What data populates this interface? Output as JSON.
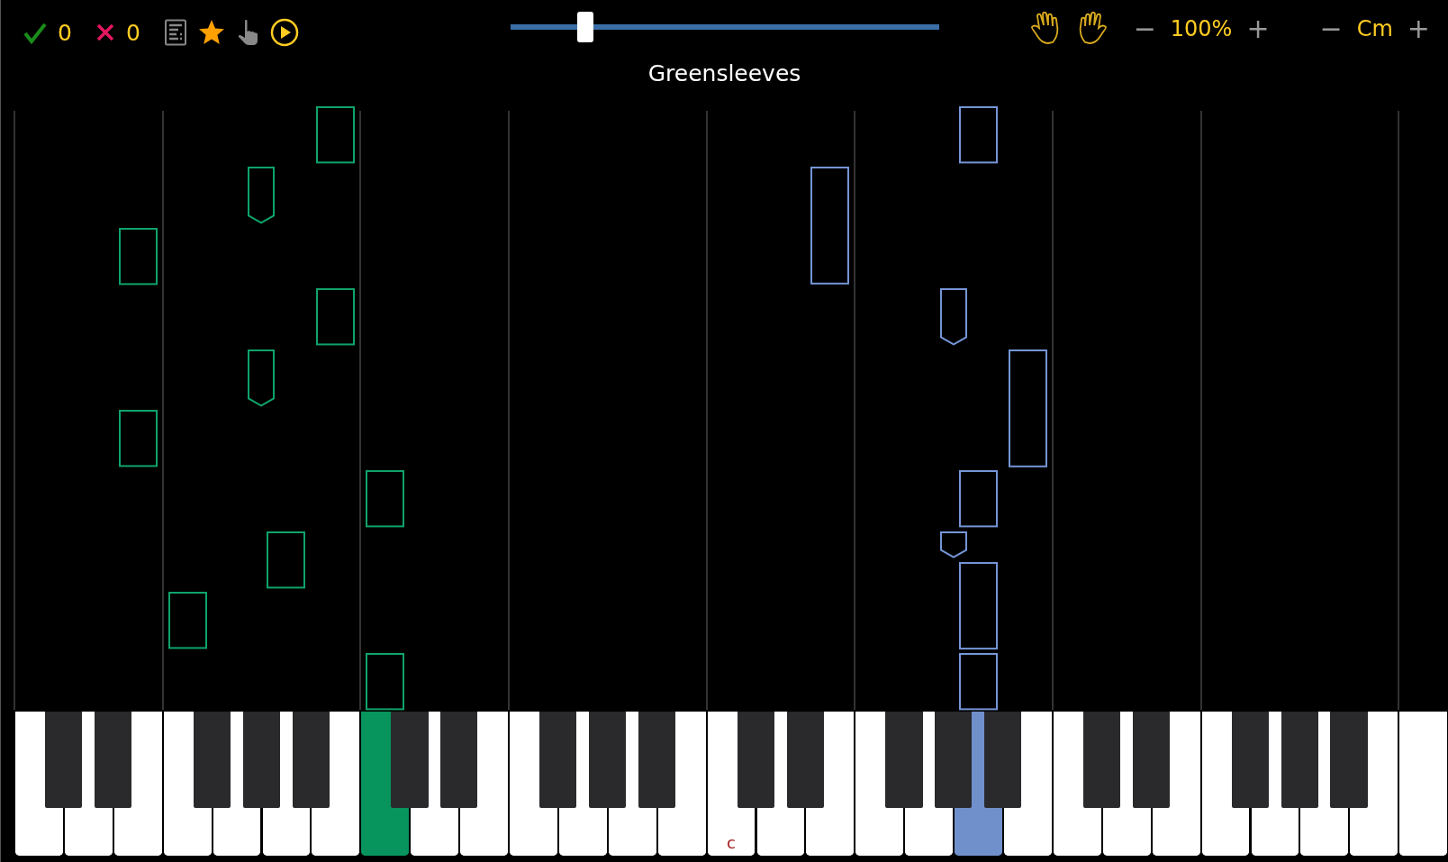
{
  "toolbar": {
    "correct_count": "0",
    "wrong_count": "0"
  },
  "tempo_slider": {
    "level": 0.175
  },
  "title": "Greensleeves",
  "zoom": {
    "decrease": "−",
    "value": "100%",
    "increase": "+"
  },
  "key_signature": {
    "decrease": "−",
    "value": "Cm",
    "increase": "+"
  },
  "tracks": [
    {
      "color": "#0fa36b"
    },
    {
      "color": "#7595d6"
    }
  ],
  "keyboard": {
    "white_keys": [
      {
        "pressed": false
      },
      {
        "pressed": false
      },
      {
        "pressed": false
      },
      {
        "pressed": false
      },
      {
        "pressed": false
      },
      {
        "pressed": false
      },
      {
        "pressed": false
      },
      {
        "pressed": true,
        "color": "#07945d"
      },
      {
        "pressed": false
      },
      {
        "pressed": false
      },
      {
        "pressed": false
      },
      {
        "pressed": false
      },
      {
        "pressed": false
      },
      {
        "pressed": false
      },
      {
        "pressed": false,
        "label": "c"
      },
      {
        "pressed": false
      },
      {
        "pressed": false
      },
      {
        "pressed": false
      },
      {
        "pressed": false
      },
      {
        "pressed": true,
        "color": "#7090cc"
      },
      {
        "pressed": false
      },
      {
        "pressed": false
      },
      {
        "pressed": false
      },
      {
        "pressed": false
      },
      {
        "pressed": false
      },
      {
        "pressed": false
      },
      {
        "pressed": false
      },
      {
        "pressed": false
      },
      {
        "pressed": false
      }
    ],
    "black_keys": [
      {
        "pressed": false
      },
      {
        "pressed": false
      },
      {
        "pressed": false
      },
      {
        "pressed": false
      },
      {
        "pressed": false
      },
      {
        "pressed": false
      },
      {
        "pressed": false
      },
      {
        "pressed": false
      },
      {
        "pressed": false
      },
      {
        "pressed": false
      },
      {
        "pressed": false
      },
      {
        "pressed": false
      },
      {
        "pressed": false
      },
      {
        "pressed": false
      },
      {
        "pressed": false
      },
      {
        "pressed": false
      },
      {
        "pressed": false
      },
      {
        "pressed": false
      },
      {
        "pressed": false
      },
      {
        "pressed": false
      }
    ]
  }
}
